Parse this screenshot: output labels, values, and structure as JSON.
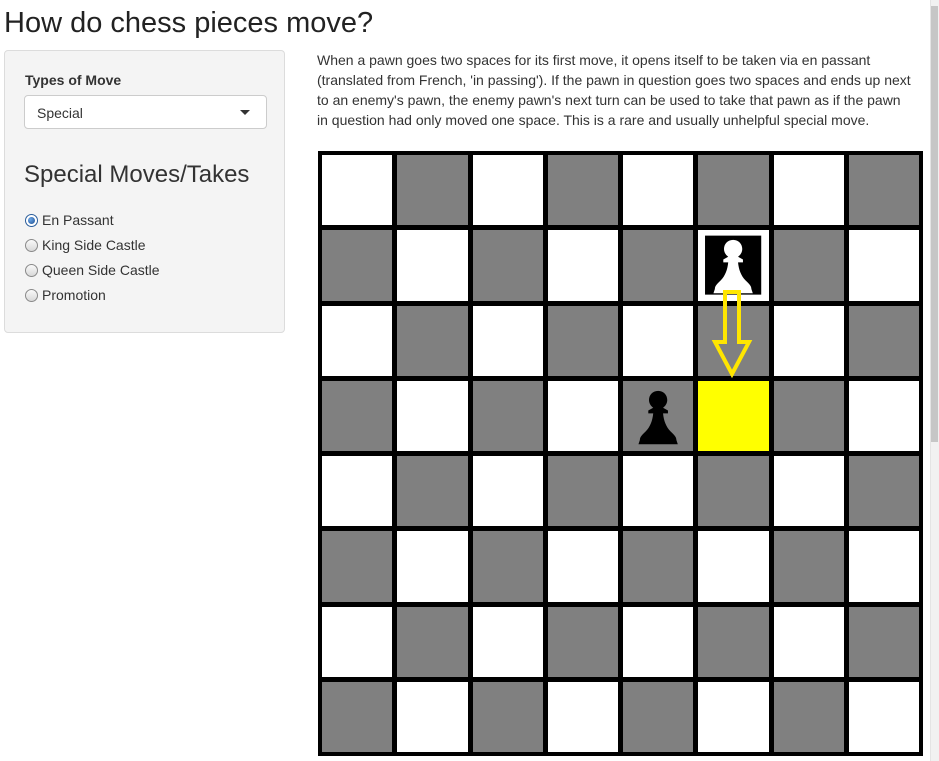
{
  "page": {
    "title": "How do chess pieces move?"
  },
  "sidebar": {
    "select_label": "Types of Move",
    "select_value": "Special",
    "section_heading": "Special Moves/Takes",
    "radios": [
      {
        "label": "En Passant",
        "checked": true
      },
      {
        "label": "King Side Castle",
        "checked": false
      },
      {
        "label": "Queen Side Castle",
        "checked": false
      },
      {
        "label": "Promotion",
        "checked": false
      }
    ]
  },
  "main": {
    "description": "When a pawn goes two spaces for its first move, it opens itself to be taken via en passant (translated from French, 'in passing'). If the pawn in question goes two spaces and ends up next to an enemy's pawn, the enemy pawn's next turn can be used to take that pawn as if the pawn in question had only moved one space. This is a rare and usually unhelpful special move."
  },
  "board": {
    "size": 8,
    "colors": {
      "light": "#ffffff",
      "dark": "#808080",
      "highlight": "#ffff00",
      "arrow": "#ffe600"
    },
    "highlight_squares": [
      [
        3,
        5
      ]
    ],
    "pieces": [
      {
        "row": 1,
        "col": 5,
        "type": "pawn",
        "color": "white",
        "icon": "white-pawn-icon"
      },
      {
        "row": 3,
        "col": 4,
        "type": "pawn",
        "color": "black",
        "icon": "black-pawn-icon"
      }
    ],
    "arrow": {
      "from": [
        1,
        5
      ],
      "to": [
        3,
        5
      ],
      "icon": "down-arrow-icon"
    }
  }
}
